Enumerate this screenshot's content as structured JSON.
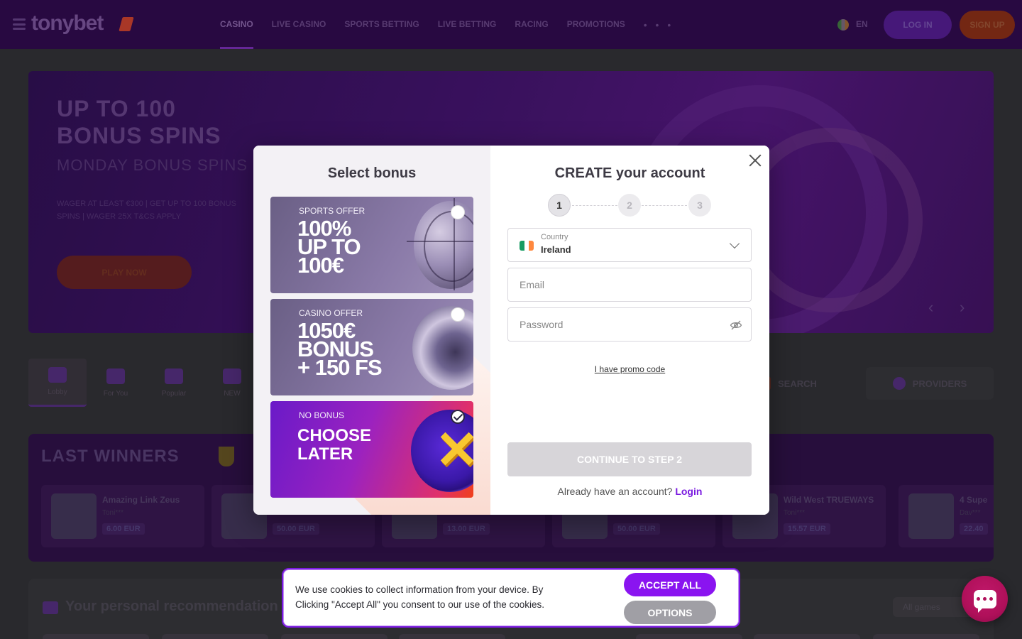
{
  "topbar": {
    "logo": "tonybet",
    "nav": [
      "Casino",
      "Live Casino",
      "Sports Betting",
      "Live Betting",
      "Racing",
      "Promotions"
    ],
    "nav_more": "• • •",
    "lang": "EN",
    "login": "LOG IN",
    "signup": "SIGN UP"
  },
  "hero": {
    "title_line1": "UP TO 100",
    "title_line2": "BONUS SPINS",
    "subtitle": "MONDAY BONUS SPINS",
    "small": "WAGER AT LEAST €300 | GET UP TO 100 BONUS SPINS | WAGER 25X T&CS APPLY",
    "cta": "PLAY NOW",
    "arrow_prev": "‹",
    "arrow_next": "›"
  },
  "categories": [
    {
      "label": "Lobby"
    },
    {
      "label": "For You"
    },
    {
      "label": "Popular"
    },
    {
      "label": "NEW"
    }
  ],
  "search_label": "SEARCH",
  "providers_label": "PROVIDERS",
  "winners": {
    "title": "LAST WINNERS",
    "cards": [
      {
        "name": "Amazing Link Zeus",
        "user": "Toni***",
        "amount": "6.00 EUR"
      },
      {
        "name": "",
        "user": "",
        "amount": "50.00 EUR"
      },
      {
        "name": "",
        "user": "",
        "amount": "13.00 EUR"
      },
      {
        "name": "",
        "user": "",
        "amount": "50.00 EUR"
      },
      {
        "name": "Wild West TRUEWAYS",
        "user": "Toni***",
        "amount": "15.57 EUR"
      },
      {
        "name": "4 Supe",
        "user": "Dav***",
        "amount": "22.40"
      }
    ]
  },
  "recs": {
    "title": "Your personal recommendation",
    "all_games": "All games"
  },
  "modal": {
    "select_title": "Select bonus",
    "bonuses": [
      {
        "tag": "SPORTS OFFER",
        "line1": "100%",
        "line2": "UP TO",
        "line3": "100€",
        "checked": false
      },
      {
        "tag": "CASINO OFFER",
        "line1": "1050€",
        "line2": "BONUS",
        "line3": "+ 150 FS",
        "checked": false
      },
      {
        "tag": "NO BONUS",
        "line1": "CHOOSE",
        "line2": "LATER",
        "line3": "",
        "checked": true
      }
    ],
    "create_title": "CREATE your account",
    "steps": [
      "1",
      "2",
      "3"
    ],
    "current_step": 1,
    "country_label": "Country",
    "country_value": "Ireland",
    "email_placeholder": "Email",
    "email_value": "",
    "password_placeholder": "Password",
    "password_value": "",
    "promo_link": "I have promo code",
    "continue_label": "CONTINUE TO STEP 2",
    "have_account": "Already have an account?",
    "login_link": "Login"
  },
  "cookie": {
    "text": "We use cookies to collect information from your device. By Clicking \"Accept All\" you consent to our use of the cookies.",
    "accept": "ACCEPT ALL",
    "options": "OPTIONS"
  },
  "colors": {
    "accent": "#8a14f0",
    "login_link": "#7a1ae0",
    "continue_disabled": "#d7d5d9",
    "chat": "#b0105a"
  }
}
